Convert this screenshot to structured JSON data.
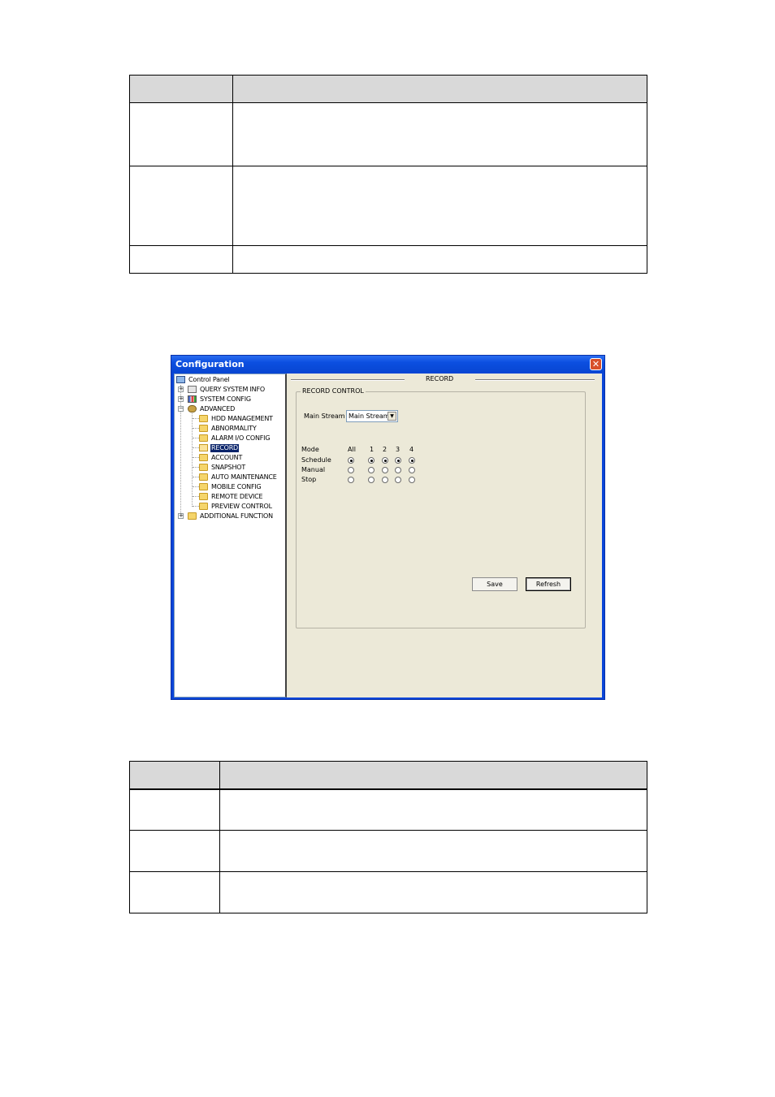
{
  "window": {
    "title": "Configuration",
    "close_label": "✕"
  },
  "tree": {
    "root": "Control Panel",
    "items": [
      {
        "label": "QUERY SYSTEM INFO"
      },
      {
        "label": "SYSTEM CONFIG"
      },
      {
        "label": "ADVANCED"
      },
      {
        "label": "HDD MANAGEMENT"
      },
      {
        "label": "ABNORMALITY"
      },
      {
        "label": "ALARM I/O CONFIG"
      },
      {
        "label": "RECORD"
      },
      {
        "label": "ACCOUNT"
      },
      {
        "label": "SNAPSHOT"
      },
      {
        "label": "AUTO MAINTENANCE"
      },
      {
        "label": "MOBILE CONFIG"
      },
      {
        "label": "REMOTE DEVICE"
      },
      {
        "label": "PREVIEW CONTROL"
      },
      {
        "label": "ADDITIONAL FUNCTION"
      }
    ],
    "expander_plus": "+",
    "expander_minus": "−"
  },
  "record": {
    "section_title": "RECORD",
    "group_title": "RECORD CONTROL",
    "stream_label": "Main Stream",
    "stream_value": "Main Stream",
    "mode_label": "Mode",
    "all_label": "All",
    "channels": [
      "1",
      "2",
      "3",
      "4"
    ],
    "rows": [
      {
        "label": "Schedule",
        "all": true,
        "channels": [
          true,
          true,
          true,
          true
        ]
      },
      {
        "label": "Manual",
        "all": false,
        "channels": [
          false,
          false,
          false,
          false
        ]
      },
      {
        "label": "Stop",
        "all": false,
        "channels": [
          false,
          false,
          false,
          false
        ]
      }
    ],
    "save_label": "Save",
    "refresh_label": "Refresh"
  }
}
